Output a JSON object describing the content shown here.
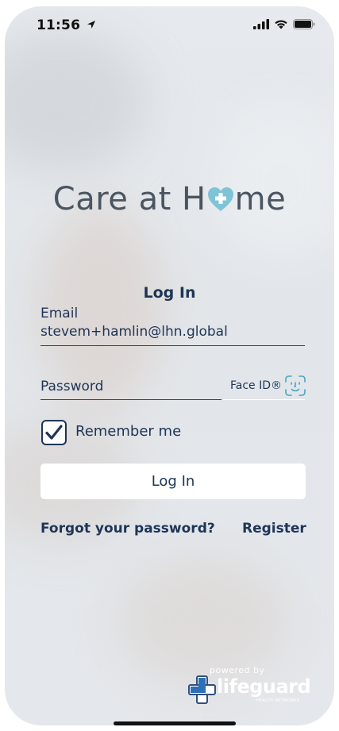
{
  "status_bar": {
    "time": "11:56"
  },
  "app": {
    "logo_part1": "Care at H",
    "logo_part2": "me"
  },
  "login": {
    "title": "Log In",
    "email_label": "Email",
    "email_value": "stevem+hamlin@lhn.global",
    "password_placeholder": "Password",
    "faceid_label": "Face ID®",
    "remember_label": "Remember me",
    "remember_checked": true,
    "login_button": "Log In",
    "forgot_link": "Forgot your password?",
    "register_link": "Register"
  },
  "footer": {
    "powered_by": "powered by",
    "brand": "lifeguard",
    "brand_sub": "HEALTH NETWORKS"
  },
  "colors": {
    "primary_text": "#1e3556",
    "logo_text": "#4b5560",
    "heart": "#7fc4d6",
    "background": "#e4e8ec"
  }
}
